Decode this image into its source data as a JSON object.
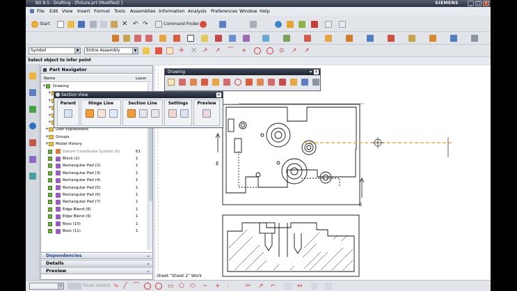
{
  "window": {
    "title": "NX 8.5 - Drafting - [fixture.prt (Modified) ]",
    "brand": "SIEMENS",
    "min": "_",
    "max": "□",
    "close": "x"
  },
  "menu": [
    "File",
    "Edit",
    "View",
    "Insert",
    "Format",
    "Tools",
    "Assemblies",
    "Information",
    "Analysis",
    "Preferences",
    "Window",
    "Help"
  ],
  "toolbar1": {
    "start_label": "Start",
    "command_finder": "Command Finder"
  },
  "selection": {
    "filter": "Symbol",
    "scope": "Entire Assembly"
  },
  "status": {
    "prompt": "Select object to infer point"
  },
  "navigator": {
    "title": "Part Navigator",
    "col_name": "Name",
    "col_layer": "Layer",
    "rows": [
      {
        "label": "Drawing",
        "layer": ""
      },
      {
        "label": "",
        "layer": ""
      },
      {
        "label": "",
        "layer": ""
      },
      {
        "label": "",
        "layer": ""
      },
      {
        "label": "",
        "layer": ""
      },
      {
        "label": "",
        "layer": ""
      },
      {
        "label": "User Expressions",
        "layer": ""
      },
      {
        "label": "Groups",
        "layer": ""
      },
      {
        "label": "Model History",
        "layer": ""
      },
      {
        "label": "Datum Coordinate System (0)",
        "layer": "61"
      },
      {
        "label": "Block (1)",
        "layer": "1"
      },
      {
        "label": "Rectangular Pad (2)",
        "layer": "1"
      },
      {
        "label": "Rectangular Pad (3)",
        "layer": "1"
      },
      {
        "label": "Rectangular Pad (4)",
        "layer": "1"
      },
      {
        "label": "Rectangular Pad (5)",
        "layer": "1"
      },
      {
        "label": "Rectangular Pad (6)",
        "layer": "1"
      },
      {
        "label": "Rectangular Pad (7)",
        "layer": "1"
      },
      {
        "label": "Edge Blend (8)",
        "layer": "1"
      },
      {
        "label": "Edge Blend (9)",
        "layer": "1"
      },
      {
        "label": "Boss (10)",
        "layer": "1"
      },
      {
        "label": "Boss (11)",
        "layer": "1"
      }
    ],
    "panels": [
      "Dependencies",
      "Details",
      "Preview"
    ]
  },
  "drawing_toolbar": {
    "title": "Drawing"
  },
  "section_view": {
    "title": "Section View",
    "groups": [
      {
        "label": "Parent"
      },
      {
        "label": "Hinge Line"
      },
      {
        "label": "Section Line"
      },
      {
        "label": "Settings"
      },
      {
        "label": "Preview"
      }
    ]
  },
  "canvas": {
    "label_e1": "E",
    "label_e2": "E",
    "sheet_label": "Sheet \"Sheet 2\" Work"
  },
  "bottom": {
    "finish_sketch": "Finish Sketch"
  },
  "colors": {
    "accent_orange": "#f39a25",
    "sketch_blue": "#2c62d1",
    "ui_bg": "#dfe3e8"
  }
}
